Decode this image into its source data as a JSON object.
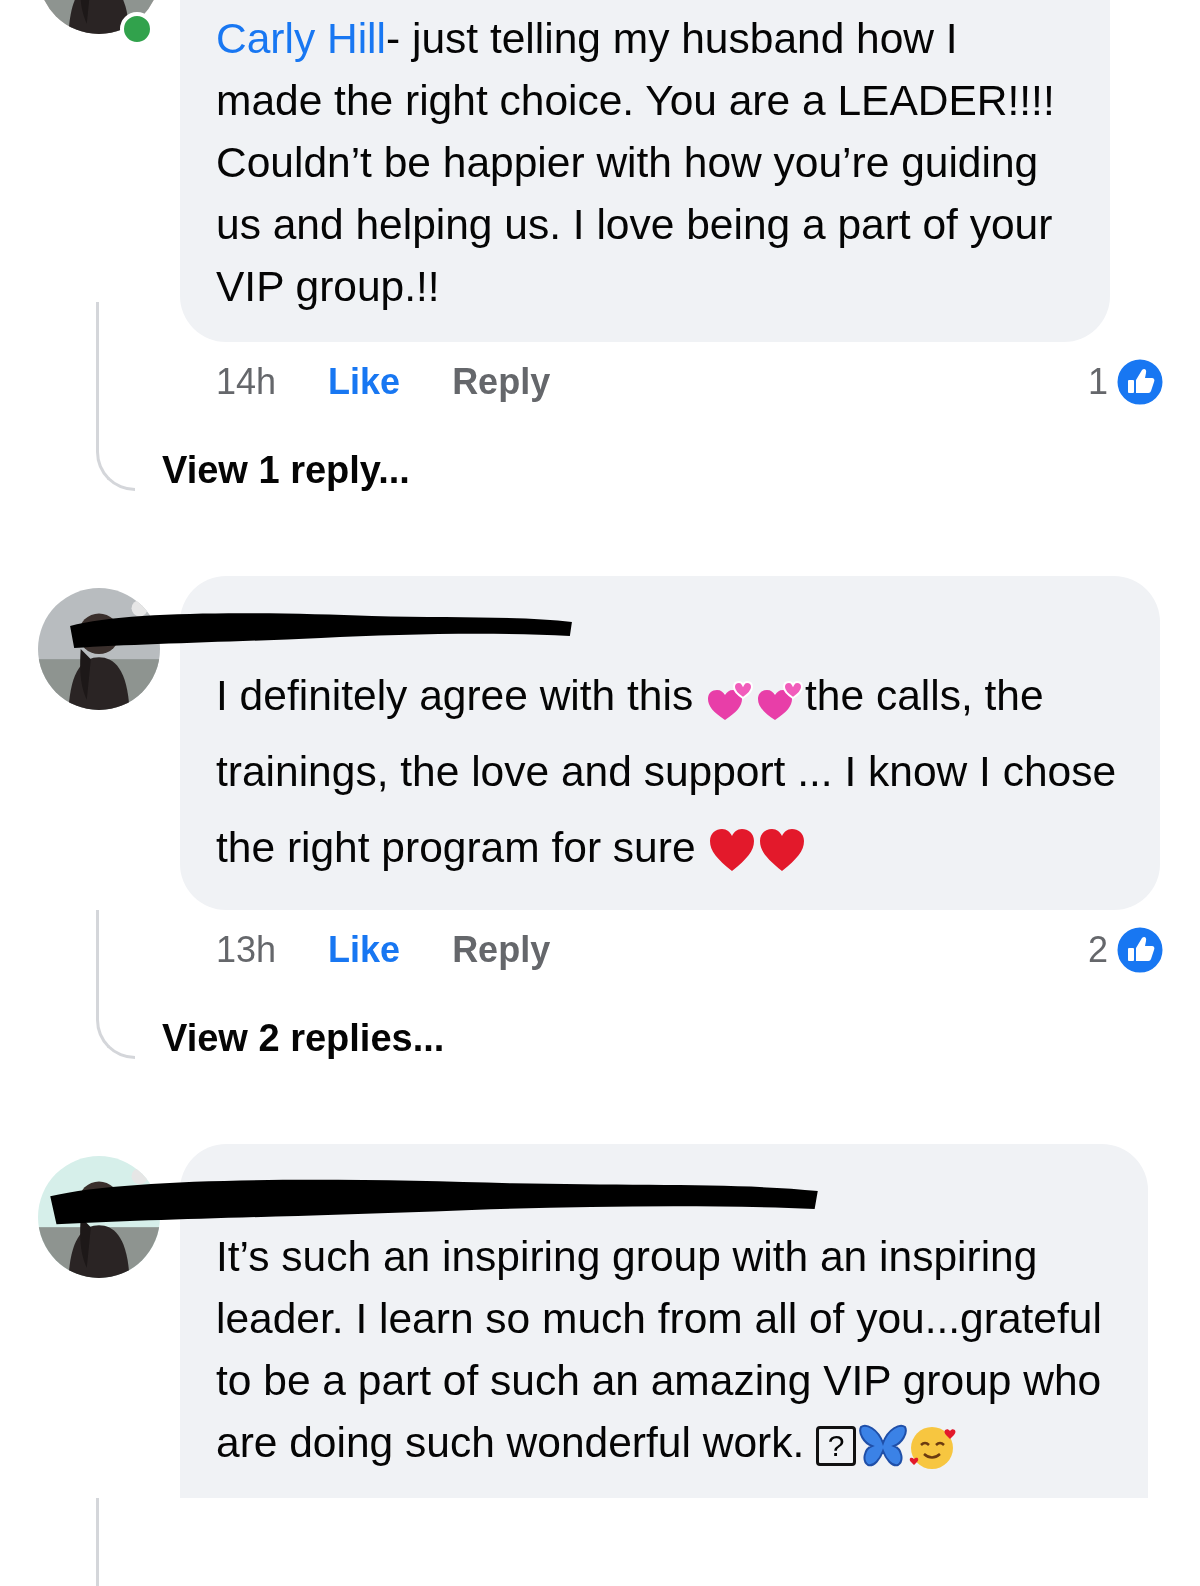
{
  "comments": [
    {
      "online": true,
      "author_link": "Carly Hill",
      "body": [
        {
          "kind": "text",
          "text": "- just telling my husband how I made the right choice. You are a LEADER!!!! Couldn’t be happier with how you’re guiding us and helping us. I love being a part of your VIP group.!!"
        }
      ],
      "time": "14h",
      "like": {
        "label": "Like",
        "liked": true
      },
      "reply": "Reply",
      "reaction_count": "1",
      "view_replies": "View 1 reply..."
    },
    {
      "author_redacted": true,
      "body": [
        {
          "kind": "text",
          "text": "I definitely agree with this "
        },
        {
          "kind": "hearts"
        },
        {
          "kind": "hearts"
        },
        {
          "kind": "text",
          "text": "the calls, the trainings, the love and support ... I know I chose the right program for sure "
        },
        {
          "kind": "heart"
        },
        {
          "kind": "heart"
        }
      ],
      "time": "13h",
      "like": {
        "label": "Like",
        "liked": true
      },
      "reply": "Reply",
      "reaction_count": "2",
      "view_replies": "View 2 replies..."
    },
    {
      "author_redacted": true,
      "body": [
        {
          "kind": "text",
          "text": "It’s such an inspiring group with an inspiring leader. I learn so much from all of you...grateful to be a part of such an amazing VIP group who are doing such wonderful work. "
        },
        {
          "kind": "glyph",
          "text": "?"
        },
        {
          "kind": "butterfly"
        },
        {
          "kind": "smiley"
        }
      ]
    }
  ]
}
